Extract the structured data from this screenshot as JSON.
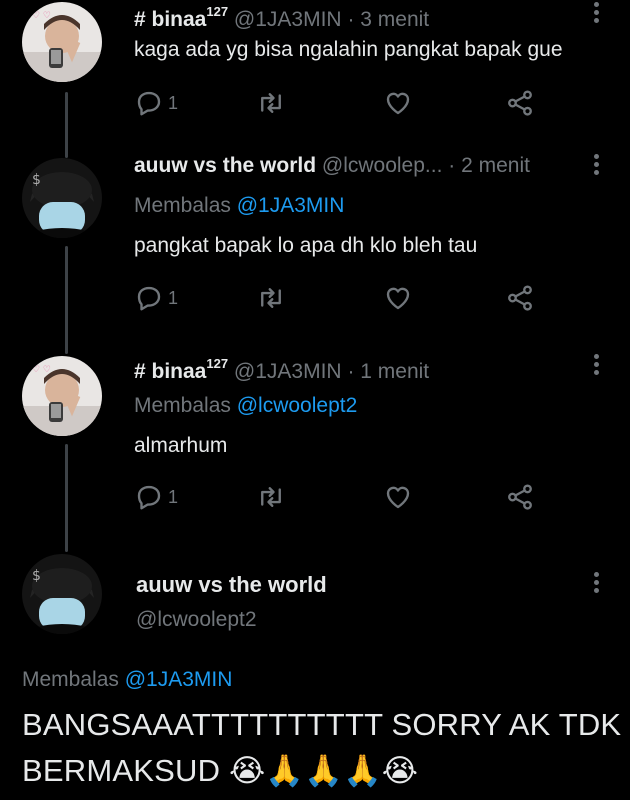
{
  "tweets": [
    {
      "name": "# binaa",
      "name_sup": "127",
      "handle": "@1JA3MIN",
      "time": "· 3 menit",
      "reply_prefix": "",
      "reply_to": "",
      "text": "kaga ada yg bisa ngalahin pangkat bapak gue",
      "reply_count": "1"
    },
    {
      "name": "auuw vs the world",
      "name_sup": "",
      "handle": "@lcwoolep...",
      "time": "· 2 menit",
      "reply_prefix": "Membalas",
      "reply_to": "@1JA3MIN",
      "text": "pangkat bapak lo apa dh klo bleh tau",
      "reply_count": "1"
    },
    {
      "name": "# binaa",
      "name_sup": "127",
      "handle": "@1JA3MIN",
      "time": "· 1 menit",
      "reply_prefix": "Membalas",
      "reply_to": "@lcwoolept2",
      "text": "almarhum",
      "reply_count": "1"
    }
  ],
  "main_tweet": {
    "name": "auuw vs the world",
    "handle": "@lcwoolept2",
    "reply_prefix": "Membalas",
    "reply_to": "@1JA3MIN",
    "text": "BANGSAAATTTTTTTTTT SORRY AK TDK BERMAKSUD 😭🙏🙏🙏😭"
  },
  "colors": {
    "background": "#000000",
    "text": "#e7e9ea",
    "muted": "#71767b",
    "link": "#1d9bf0"
  },
  "icons": [
    "reply-icon",
    "retweet-icon",
    "like-icon",
    "share-icon",
    "more-icon"
  ]
}
